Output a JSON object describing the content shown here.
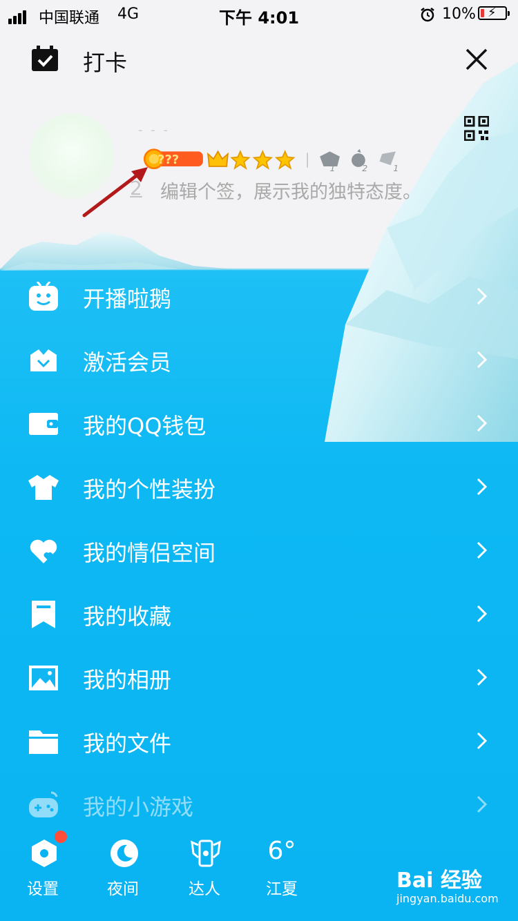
{
  "status_bar": {
    "carrier": "中国联通",
    "network": "4G",
    "time": "下午 4:01",
    "battery": "10%"
  },
  "header": {
    "title": "打卡"
  },
  "profile": {
    "badge_label": "???",
    "signature_prefix": "2",
    "signature": "编辑个签，展示我的独特态度。",
    "rank_counts": [
      "1",
      "2",
      "1"
    ]
  },
  "menu": [
    {
      "label": "开播啦鹅",
      "icon": "tv-robot-icon"
    },
    {
      "label": "激活会员",
      "icon": "crown-icon"
    },
    {
      "label": "我的QQ钱包",
      "icon": "wallet-icon"
    },
    {
      "label": "我的个性装扮",
      "icon": "shirt-icon"
    },
    {
      "label": "我的情侣空间",
      "icon": "heart-icon"
    },
    {
      "label": "我的收藏",
      "icon": "bookmark-icon"
    },
    {
      "label": "我的相册",
      "icon": "photo-icon"
    },
    {
      "label": "我的文件",
      "icon": "folder-icon"
    },
    {
      "label": "我的小游戏",
      "icon": "gamepad-icon"
    }
  ],
  "bottom_bar": {
    "settings": "设置",
    "night": "夜间",
    "expert": "达人",
    "weather_temp": "6°",
    "weather_city": "江夏"
  },
  "watermark": {
    "brand": "Bai 经验",
    "url": "jingyan.baidu.com"
  },
  "colors": {
    "sky_blue": "#0ab4f2",
    "top_bg": "#f3f3f5",
    "badge_red": "#ff4d3a"
  }
}
